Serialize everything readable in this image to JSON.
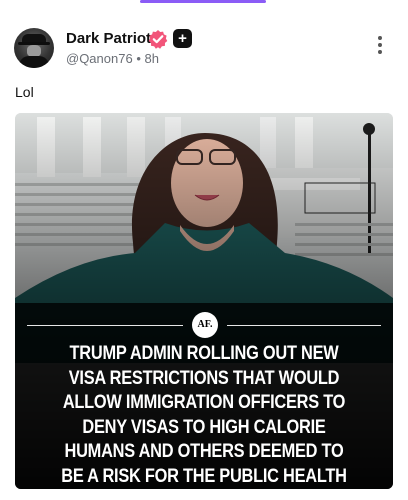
{
  "post": {
    "author": {
      "display_name": "Dark Patriot",
      "handle": "@Qanon76",
      "separator": "•",
      "time": "8h"
    },
    "plus_badge": "+",
    "body_text": "Lol",
    "media": {
      "logo_text": "AF.",
      "headline": "TRUMP ADMIN ROLLING OUT NEW VISA RESTRICTIONS THAT WOULD ALLOW IMMIGRATION OFFICERS TO DENY VISAS TO HIGH CALORIE HUMANS AND OTHERS DEEMED TO BE A RISK FOR THE PUBLIC HEALTH SYSTEM."
    }
  },
  "colors": {
    "accent": "#8b5cf6",
    "verified_badge": "#f2557a",
    "text_primary": "#111111",
    "text_secondary": "#6b6f76"
  },
  "icons": [
    "verified-badge-icon",
    "plus-icon",
    "more-options-icon"
  ]
}
